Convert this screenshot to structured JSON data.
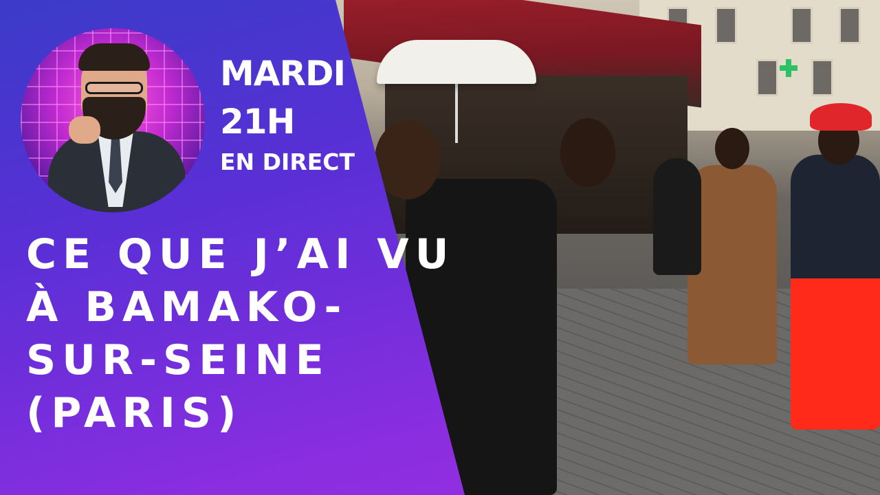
{
  "thumbnail": {
    "live": {
      "day": "MARDI",
      "hour": "21H",
      "status": "EN DIRECT"
    },
    "headline": {
      "lines": [
        "CE QUE J’AI VU",
        "À BAMAKO-",
        "SUR-SEINE",
        "(PARIS)"
      ]
    },
    "colors": {
      "panel_top": "#3b3bc8",
      "panel_bottom": "#9a30e2",
      "text": "#ffffff",
      "avatar_glow": "#ff5ad9"
    },
    "icons": {
      "avatar": "cartoon-man-pointing-avatar",
      "pharmacy": "green-cross-pharmacy-sign"
    }
  }
}
